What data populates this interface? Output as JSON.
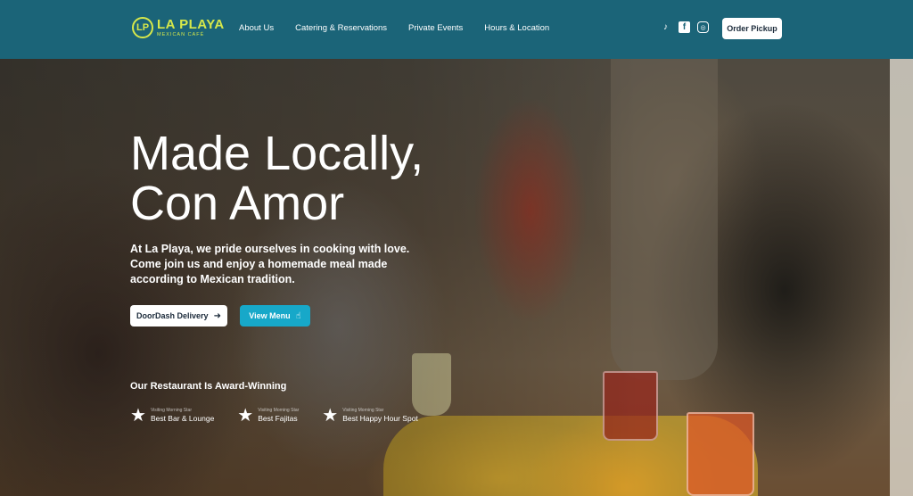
{
  "brand": {
    "badge": "LP",
    "name": "LA PLAYA",
    "subtitle": "MEXICAN CAFÉ"
  },
  "nav": {
    "items": [
      {
        "label": "About Us"
      },
      {
        "label": "Catering & Reservations"
      },
      {
        "label": "Private Events"
      },
      {
        "label": "Hours & Location"
      }
    ]
  },
  "social": {
    "tiktok_glyph": "♪",
    "facebook_glyph": "f",
    "instagram_glyph": "◎"
  },
  "header": {
    "order_label": "Order Pickup"
  },
  "hero": {
    "headline_line1": "Made Locally,",
    "headline_line2": "Con Amor",
    "subtext": "At La Playa, we pride ourselves in cooking with love. Come join us and enjoy a homemade meal made according to Mexican tradition.",
    "doordash_label": "DoorDash Delivery",
    "doordash_icon": "➜",
    "menu_label": "View Menu",
    "menu_icon": "☝"
  },
  "awards": {
    "title": "Our Restaurant Is Award-Winning",
    "items": [
      {
        "source": "Visiting Morning Star",
        "name": "Best Bar & Lounge"
      },
      {
        "source": "Visiting Morning Star",
        "name": "Best Fajitas"
      },
      {
        "source": "Visiting Morning Star",
        "name": "Best Happy Hour Spot"
      }
    ]
  },
  "colors": {
    "header_bg": "#1b6478",
    "accent": "#17a8c9",
    "logo": "#d7e84a"
  }
}
